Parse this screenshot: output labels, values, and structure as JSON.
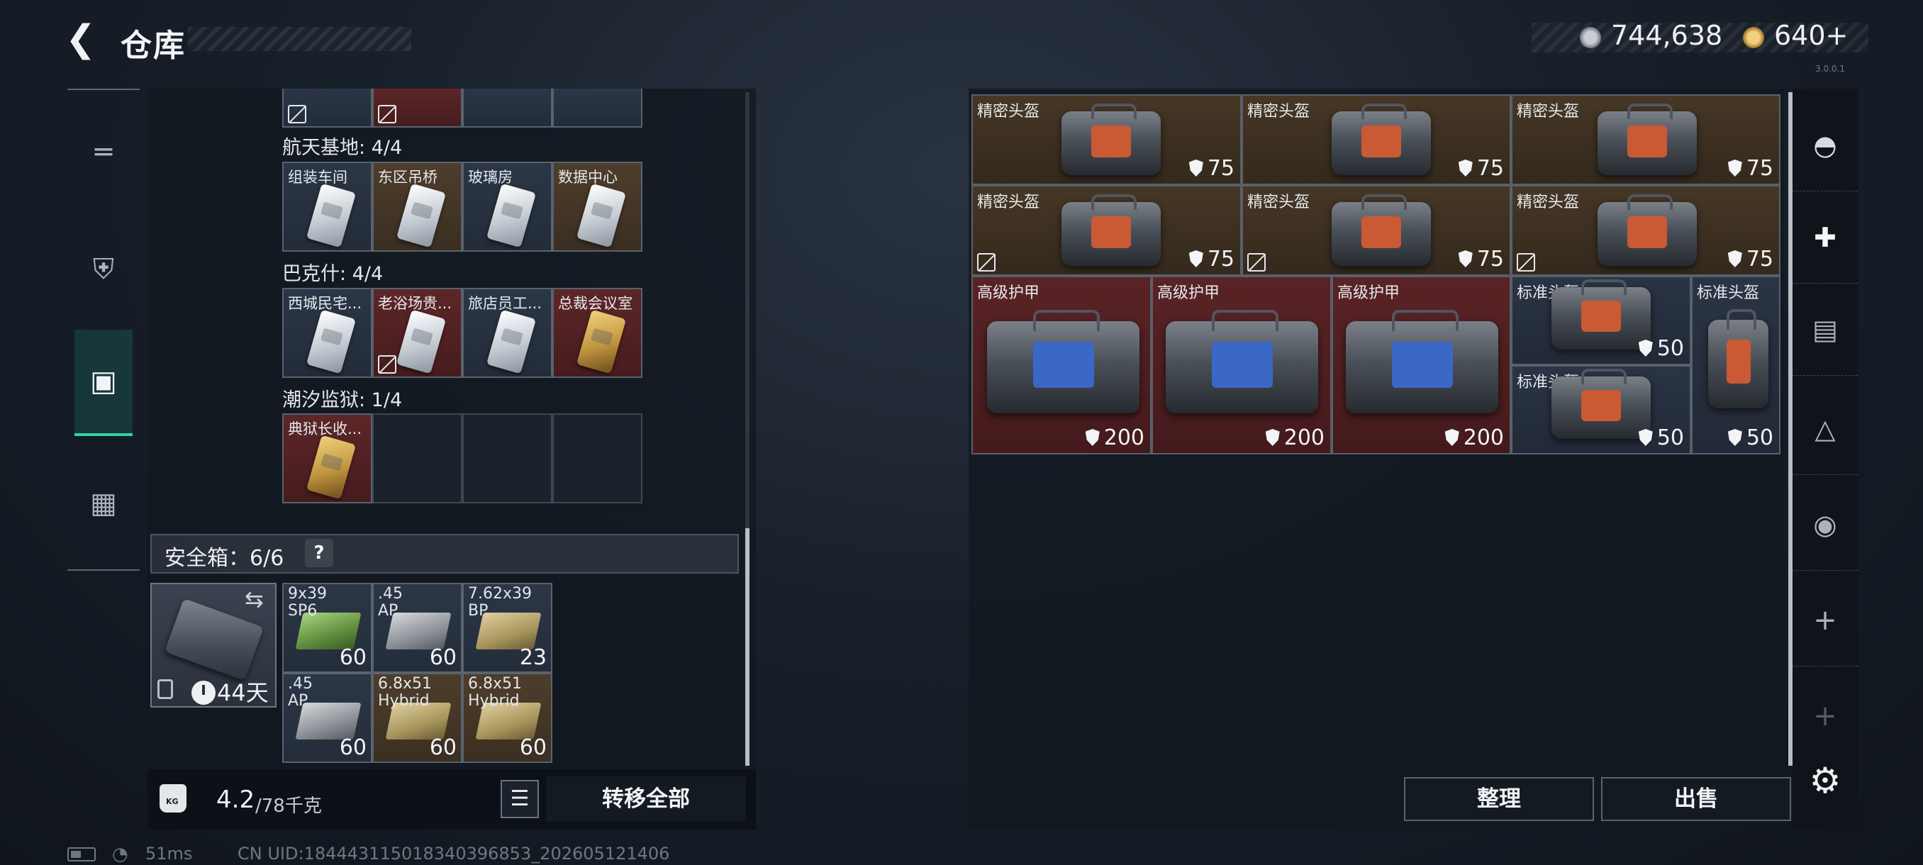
{
  "header": {
    "title": "仓库",
    "silver": "744,638",
    "gold": "640+"
  },
  "version": "3.0.0.1",
  "left_tabs": [
    {
      "name": "weapons",
      "icon": "gun-icon"
    },
    {
      "name": "gear",
      "icon": "armor-icon"
    },
    {
      "name": "storage",
      "icon": "backpack-icon",
      "active": true
    },
    {
      "name": "kits",
      "icon": "briefcase-icon"
    }
  ],
  "keycards": {
    "sections": [
      {
        "title": "航天基地: 4/4",
        "cards": [
          {
            "label": "组装车间",
            "style": "blue"
          },
          {
            "label": "东区吊桥",
            "style": "brown"
          },
          {
            "label": "玻璃房",
            "style": "blue"
          },
          {
            "label": "数据中心",
            "style": "brown"
          }
        ]
      },
      {
        "title": "巴克什: 4/4",
        "cards": [
          {
            "label": "西城民宅...",
            "style": "blue"
          },
          {
            "label": "老浴场贵...",
            "style": "red"
          },
          {
            "label": "旅店员工...",
            "style": "blue"
          },
          {
            "label": "总裁会议室",
            "style": "red"
          }
        ]
      },
      {
        "title": "潮汐监狱: 1/4",
        "cards": [
          {
            "label": "典狱长收...",
            "style": "red"
          }
        ]
      }
    ]
  },
  "safebox": {
    "title": "安全箱：6/6",
    "help": "?",
    "days_left": "44天",
    "ammo": [
      {
        "label": "9x39\nSP6",
        "qty": "60",
        "style": "blue",
        "box": "green"
      },
      {
        "label": ".45\nAP",
        "qty": "60",
        "style": "blue",
        "box": "grey"
      },
      {
        "label": "7.62x39\nBP",
        "qty": "23",
        "style": "blue",
        "box": "khaki"
      },
      {
        "label": ".45\nAP",
        "qty": "60",
        "style": "blue",
        "box": "grey"
      },
      {
        "label": "6.8x51\nHybrid",
        "qty": "60",
        "style": "brown",
        "box": "khaki"
      },
      {
        "label": "6.8x51\nHybrid",
        "qty": "60",
        "style": "brown",
        "box": "khaki"
      }
    ]
  },
  "weight": {
    "current": "4.2",
    "max": "/78千克"
  },
  "buttons": {
    "transfer_all": "转移全部",
    "sort": "整理",
    "sell": "出售"
  },
  "inventory": [
    {
      "label": "精密头盔",
      "value": "75"
    },
    {
      "label": "精密头盔",
      "value": "75"
    },
    {
      "label": "精密头盔",
      "value": "75"
    },
    {
      "label": "精密头盔",
      "value": "75"
    },
    {
      "label": "精密头盔",
      "value": "75"
    },
    {
      "label": "精密头盔",
      "value": "75"
    },
    {
      "label": "高级护甲",
      "value": "200"
    },
    {
      "label": "高级护甲",
      "value": "200"
    },
    {
      "label": "高级护甲",
      "value": "200"
    },
    {
      "label": "标准头盔",
      "value": "50"
    },
    {
      "label": "标准头盔",
      "value": "50"
    },
    {
      "label": "标准头盔",
      "value": "50"
    }
  ],
  "right_rail": [
    "helmet-icon",
    "medkit-icon",
    "folder-icon",
    "map-icon",
    "camera-icon",
    "plus-icon",
    "plus-icon"
  ],
  "status": {
    "ping": "51ms",
    "uid": "CN UID:1844431150183403968​53_202605121406"
  }
}
